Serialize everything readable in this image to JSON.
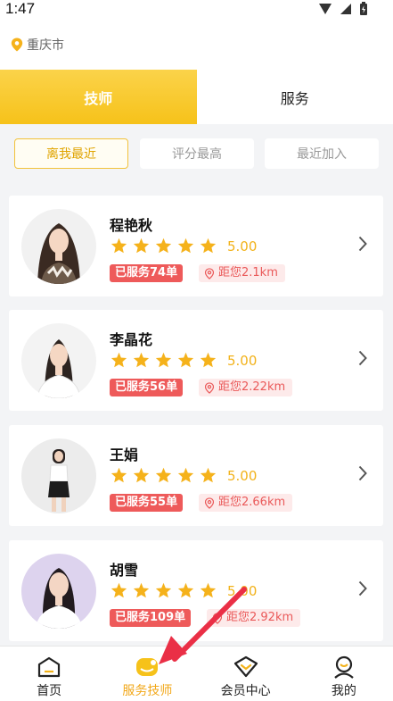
{
  "status_bar": {
    "time": "1:47"
  },
  "header": {
    "location": "重庆市"
  },
  "tabs": [
    {
      "label": "技师",
      "active": true
    },
    {
      "label": "服务",
      "active": false
    }
  ],
  "filters": [
    {
      "label": "离我最近",
      "active": true
    },
    {
      "label": "评分最高",
      "active": false
    },
    {
      "label": "最近加入",
      "active": false
    }
  ],
  "technicians": [
    {
      "name": "程艳秋",
      "rating": "5.00",
      "stars": 5,
      "served": "已服务74单",
      "distance": "距您2.1km"
    },
    {
      "name": "李晶花",
      "rating": "5.00",
      "stars": 5,
      "served": "已服务56单",
      "distance": "距您2.22km"
    },
    {
      "name": "王娟",
      "rating": "5.00",
      "stars": 5,
      "served": "已服务55单",
      "distance": "距您2.66km"
    },
    {
      "name": "胡雪",
      "rating": "5.00",
      "stars": 5,
      "served": "已服务109单",
      "distance": "距您2.92km"
    }
  ],
  "bottom_nav": [
    {
      "label": "首页",
      "icon": "home-icon",
      "active": false
    },
    {
      "label": "服务技师",
      "icon": "technician-icon",
      "active": true
    },
    {
      "label": "会员中心",
      "icon": "member-diamond-icon",
      "active": false
    },
    {
      "label": "我的",
      "icon": "profile-icon",
      "active": false
    }
  ],
  "colors": {
    "accent": "#f6c21a",
    "star": "#f5b21b",
    "served_badge": "#ee5a5a",
    "distance_bg": "#fdeaea",
    "annotation_arrow": "#ea2f46"
  }
}
